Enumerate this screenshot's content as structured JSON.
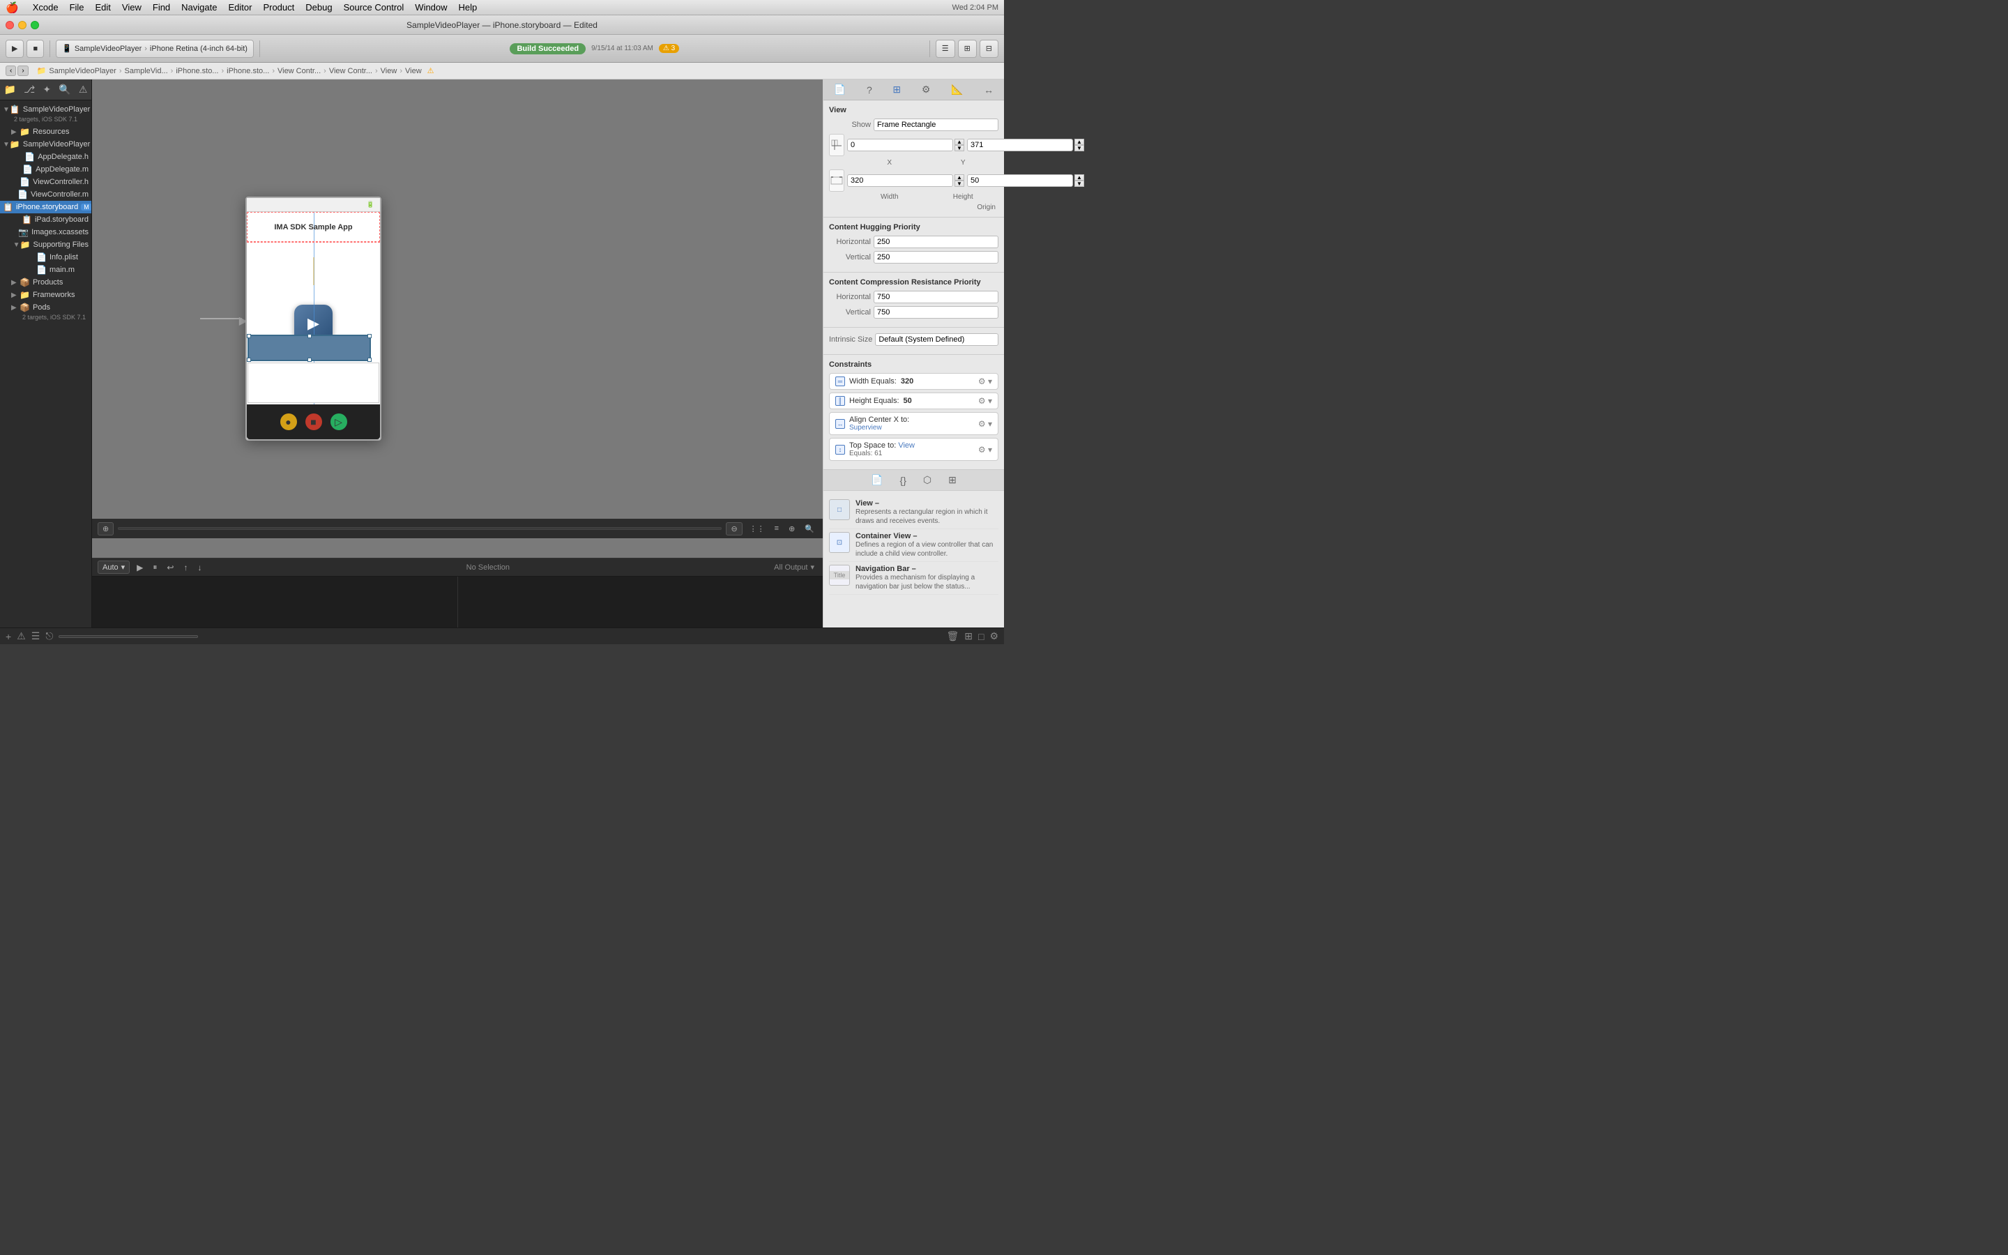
{
  "menubar": {
    "apple": "🍎",
    "items": [
      "Xcode",
      "File",
      "Edit",
      "View",
      "Find",
      "Navigate",
      "Editor",
      "Product",
      "Debug",
      "Source Control",
      "Window",
      "Help"
    ]
  },
  "titlebar": {
    "title": "SampleVideoPlayer — iPhone.storyboard — Edited"
  },
  "toolbar": {
    "scheme_label": "SampleVideoPlayer",
    "device_label": "iPhone Retina (4-inch 64-bit)",
    "build_status": "Build Succeeded",
    "build_time": "9/15/14 at 11:03 AM",
    "warning_count": "3"
  },
  "breadcrumb": {
    "items": [
      "SampleVideoPlayer",
      "SampleVid...",
      "iPhone.sto...",
      "iPhone.sto...",
      "View Contr...",
      "View Contr...",
      "View",
      "View"
    ]
  },
  "sidebar": {
    "project_name": "SampleVideoPlayer",
    "project_subtitle": "2 targets, iOS SDK 7.1",
    "items": [
      {
        "label": "Resources",
        "type": "group",
        "indent": 1,
        "icon": "📁"
      },
      {
        "label": "SampleVideoPlayer",
        "type": "group",
        "indent": 1,
        "icon": "📁",
        "expanded": true
      },
      {
        "label": "AppDelegate.h",
        "type": "file",
        "indent": 2,
        "icon": "📄"
      },
      {
        "label": "AppDelegate.m",
        "type": "file",
        "indent": 2,
        "icon": "📄"
      },
      {
        "label": "ViewController.h",
        "type": "file",
        "indent": 2,
        "icon": "📄"
      },
      {
        "label": "ViewController.m",
        "type": "file",
        "indent": 2,
        "icon": "📄"
      },
      {
        "label": "iPhone.storyboard",
        "type": "file",
        "indent": 2,
        "icon": "📋",
        "selected": true,
        "badge": "M"
      },
      {
        "label": "iPad.storyboard",
        "type": "file",
        "indent": 2,
        "icon": "📋"
      },
      {
        "label": "Images.xcassets",
        "type": "file",
        "indent": 2,
        "icon": "📷"
      },
      {
        "label": "Supporting Files",
        "type": "group",
        "indent": 2,
        "icon": "📁",
        "expanded": true
      },
      {
        "label": "Info.plist",
        "type": "file",
        "indent": 3,
        "icon": "📄"
      },
      {
        "label": "main.m",
        "type": "file",
        "indent": 3,
        "icon": "📄"
      },
      {
        "label": "Products",
        "type": "group",
        "indent": 1,
        "icon": "📦"
      },
      {
        "label": "Frameworks",
        "type": "group",
        "indent": 1,
        "icon": "📁"
      },
      {
        "label": "Pods",
        "type": "group",
        "indent": 1,
        "icon": "📦",
        "expanded": false
      },
      {
        "label": "2 targets, iOS SDK 7.1",
        "type": "subtitle",
        "indent": 2,
        "icon": ""
      }
    ]
  },
  "storyboard": {
    "tab_label": "iPhone storyboard",
    "app_title": "IMA SDK Sample App"
  },
  "inspector": {
    "section_title": "View",
    "show_label": "Show",
    "show_value": "Frame Rectangle",
    "origin_x": "0",
    "origin_y": "371",
    "origin_label": "Origin",
    "width_value": "320",
    "height_value": "50",
    "size_label": "Width",
    "height_label": "Height",
    "content_hugging_title": "Content Hugging Priority",
    "horiz_label": "Horizontal",
    "horiz_value": "250",
    "vert_label": "Vertical",
    "vert_value": "250",
    "compression_title": "Content Compression Resistance Priority",
    "comp_horiz_value": "750",
    "comp_vert_value": "750",
    "intrinsic_label": "Intrinsic Size",
    "intrinsic_value": "Default (System Defined)",
    "constraints_title": "Constraints",
    "constraints": [
      {
        "label": "Width Equals:",
        "value": "320"
      },
      {
        "label": "Height Equals:",
        "value": "50"
      },
      {
        "label": "Align Center X to:",
        "sublabel": "Superview"
      },
      {
        "label": "Top Space to:",
        "sublabel": "View",
        "value": "Equals: 61"
      }
    ]
  },
  "objects": [
    {
      "name": "View",
      "desc": "Represents a rectangular region in which it draws and receives events."
    },
    {
      "name": "Container View",
      "desc": "Defines a region of a view controller that can include a child view controller."
    },
    {
      "name": "Navigation Bar",
      "desc": "Provides a mechanism for displaying a navigation bar just below the status..."
    }
  ],
  "status_bar": {
    "no_selection": "No Selection",
    "output_label": "All Output"
  },
  "debug": {
    "auto_label": "Auto"
  }
}
